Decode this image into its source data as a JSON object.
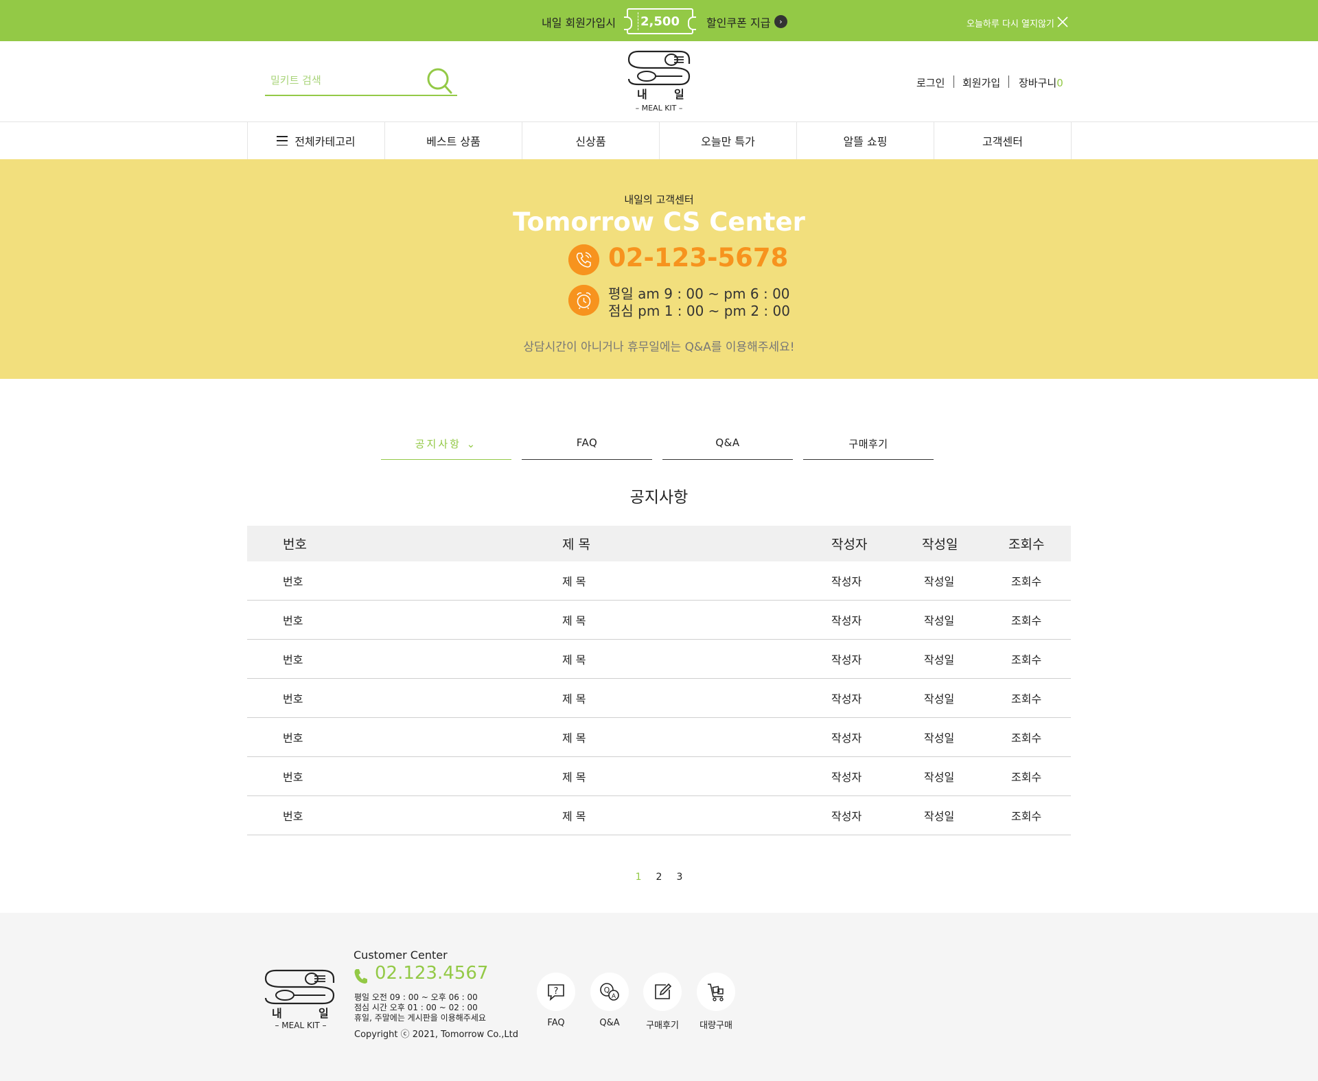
{
  "promo": {
    "text_before": "내일 회원가입시",
    "coupon_amount": "2,500",
    "text_after": "할인쿠폰 지급",
    "dismiss_label": "오늘하루 다시 열지않기"
  },
  "header": {
    "search_placeholder": "밀키트 검색",
    "logo": {
      "line1_left": "내",
      "line1_right": "일",
      "line2": "– MEAL KIT –"
    },
    "util": {
      "login": "로그인",
      "join": "회원가입",
      "cart_label": "장바구니",
      "cart_count": "0"
    }
  },
  "gnb": {
    "items": [
      {
        "label": "전체카테고리"
      },
      {
        "label": "베스트 상품"
      },
      {
        "label": "신상품"
      },
      {
        "label": "오늘만 특가"
      },
      {
        "label": "알뜰 쇼핑"
      },
      {
        "label": "고객센터"
      }
    ]
  },
  "hero": {
    "subtitle": "내일의 고객센터",
    "title": "Tomorrow CS Center",
    "phone": "02-123-5678",
    "hours_line1": "평일 am 9 : 00 ~ pm 6 : 00",
    "hours_line2": "점심 pm 1 : 00 ~ pm 2 : 00",
    "note": "상담시간이 아니거나 휴무일에는 Q&A를 이용해주세요!"
  },
  "tabs": [
    {
      "label": "공지사항 ⌄",
      "active": true
    },
    {
      "label": "FAQ",
      "active": false
    },
    {
      "label": "Q&A",
      "active": false
    },
    {
      "label": "구매후기",
      "active": false
    }
  ],
  "board": {
    "title": "공지사항",
    "columns": [
      "번호",
      "제 목",
      "작성자",
      "작성일",
      "조회수"
    ],
    "rows": [
      [
        "번호",
        "제 목",
        "작성자",
        "작성일",
        "조회수"
      ],
      [
        "번호",
        "제 목",
        "작성자",
        "작성일",
        "조회수"
      ],
      [
        "번호",
        "제 목",
        "작성자",
        "작성일",
        "조회수"
      ],
      [
        "번호",
        "제 목",
        "작성자",
        "작성일",
        "조회수"
      ],
      [
        "번호",
        "제 목",
        "작성자",
        "작성일",
        "조회수"
      ],
      [
        "번호",
        "제 목",
        "작성자",
        "작성일",
        "조회수"
      ],
      [
        "번호",
        "제 목",
        "작성자",
        "작성일",
        "조회수"
      ]
    ]
  },
  "pagination": {
    "pages": [
      "1",
      "2",
      "3"
    ],
    "current": "1"
  },
  "footer": {
    "logo": {
      "line1_left": "내",
      "line1_right": "일",
      "line2": "– MEAL KIT –"
    },
    "cc_label": "Customer Center",
    "phone": "02.123.4567",
    "info_line1": "평일 오전 09 : 00 ~ 오후 06 : 00",
    "info_line2": "점심 시간 오후 01 : 00 ~ 02 : 00",
    "info_line3": "휴일, 주말에는 게시판을 이용해주세요",
    "copyright": "Copyright ⓒ 2021, Tomorrow Co.,Ltd",
    "links": [
      {
        "label": "FAQ",
        "icon": "faq-icon"
      },
      {
        "label": "Q&A",
        "icon": "qna-icon"
      },
      {
        "label": "구매후기",
        "icon": "review-icon"
      },
      {
        "label": "대량구매",
        "icon": "bulk-order-icon"
      }
    ]
  },
  "colors": {
    "accent_green": "#93c946",
    "hero_yellow": "#f2df7d",
    "orange": "#f7931e"
  }
}
